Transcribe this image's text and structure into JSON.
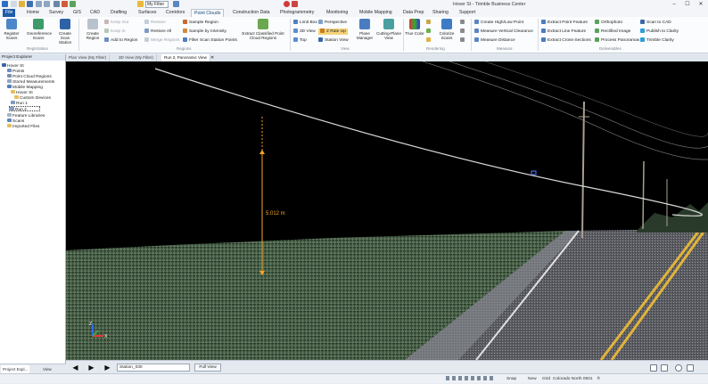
{
  "titlebar": {
    "window_title": "Hover St - Trimble Business Center",
    "filter_value": "My Filter",
    "controls": {
      "minimize": "–",
      "maximize": "☐",
      "close": "✕"
    }
  },
  "tabs": [
    "File",
    "Home",
    "Survey",
    "GIS",
    "CAD",
    "Drafting",
    "Surfaces",
    "Corridors",
    "Point Clouds",
    "Construction Data",
    "Photogrammetry",
    "Monitoring",
    "Mobile Mapping",
    "Data Prep",
    "Sharing",
    "Support"
  ],
  "ribbon": {
    "registration": {
      "register": "Register Scans",
      "georef": "Georeference Scans",
      "create_station": "Create Scan Station",
      "group": "Registration"
    },
    "regions": {
      "create": "Create Region",
      "keep_out": "Keep Out",
      "keep_in": "Keep In",
      "add": "Add to Region",
      "restore": "Restore",
      "restore_all": "Restore All",
      "merge": "Merge Regions",
      "sample": "Sample Region",
      "sample_intensity": "Sample by Intensity",
      "filter_station": "Filter Scan Station Points",
      "extract": "Extract Classified Point Cloud Regions",
      "group": "Regions"
    },
    "view": {
      "limit_box": "Limit Box",
      "view3d": "3D View",
      "top": "Top",
      "perspective": "Perspective",
      "zrate": "Z Rate Up",
      "station_view": "Station View",
      "plane_manager": "Plane Manager",
      "cutting_plane": "Cutting-Plane View",
      "group": "View"
    },
    "rendering": {
      "true_color": "True Color",
      "colorize": "Colorize Scans",
      "group": "Rendering"
    },
    "measure": {
      "create_hl": "Create High/Low Point",
      "measure_vc": "Measure Vertical Clearance",
      "measure_dist": "Measure Distance",
      "group": "Measure"
    },
    "extract": {
      "point_feature": "Extract Point Feature",
      "line_feature": "Extract Line Feature",
      "cross_sections": "Extract Cross-Sections",
      "orthophoto": "Orthophoto",
      "rectified": "Rectified Image",
      "process_panoramas": "Process Panoramas",
      "scan_to_cad": "Scan to CAD",
      "publish_clarity": "Publish to Clarity",
      "trimble_clarity": "Trimble Clarity",
      "group": "Deliverables"
    }
  },
  "doc_tabs": [
    "Plan View (My Filter)",
    "3D View (My Filter)",
    "Run 2, Panoramic View"
  ],
  "explorer": {
    "title": "Project Explorer",
    "items": [
      "Hover St",
      "Points",
      "Point Cloud Regions",
      "Stored Measurements",
      "Mobile Mapping",
      "Hover St",
      "Custom Devices",
      "Run 1",
      "Run 2",
      "Feature Libraries",
      "Scans",
      "Imported Files"
    ],
    "bottom_tabs": [
      "Project Expl...",
      "View Filter..."
    ]
  },
  "viewport": {
    "measure_label": "5.012 m",
    "axis_z": "Z",
    "axis_x": "X"
  },
  "playbar": {
    "station": "Station_030",
    "full_view": "Full View",
    "prev": "◀",
    "play": "▶",
    "next": "▶"
  },
  "status": {
    "snap": "Snap",
    "new": "New",
    "grid": "Grid",
    "coord_system": "Colorado North 0501",
    "units": "ft"
  }
}
